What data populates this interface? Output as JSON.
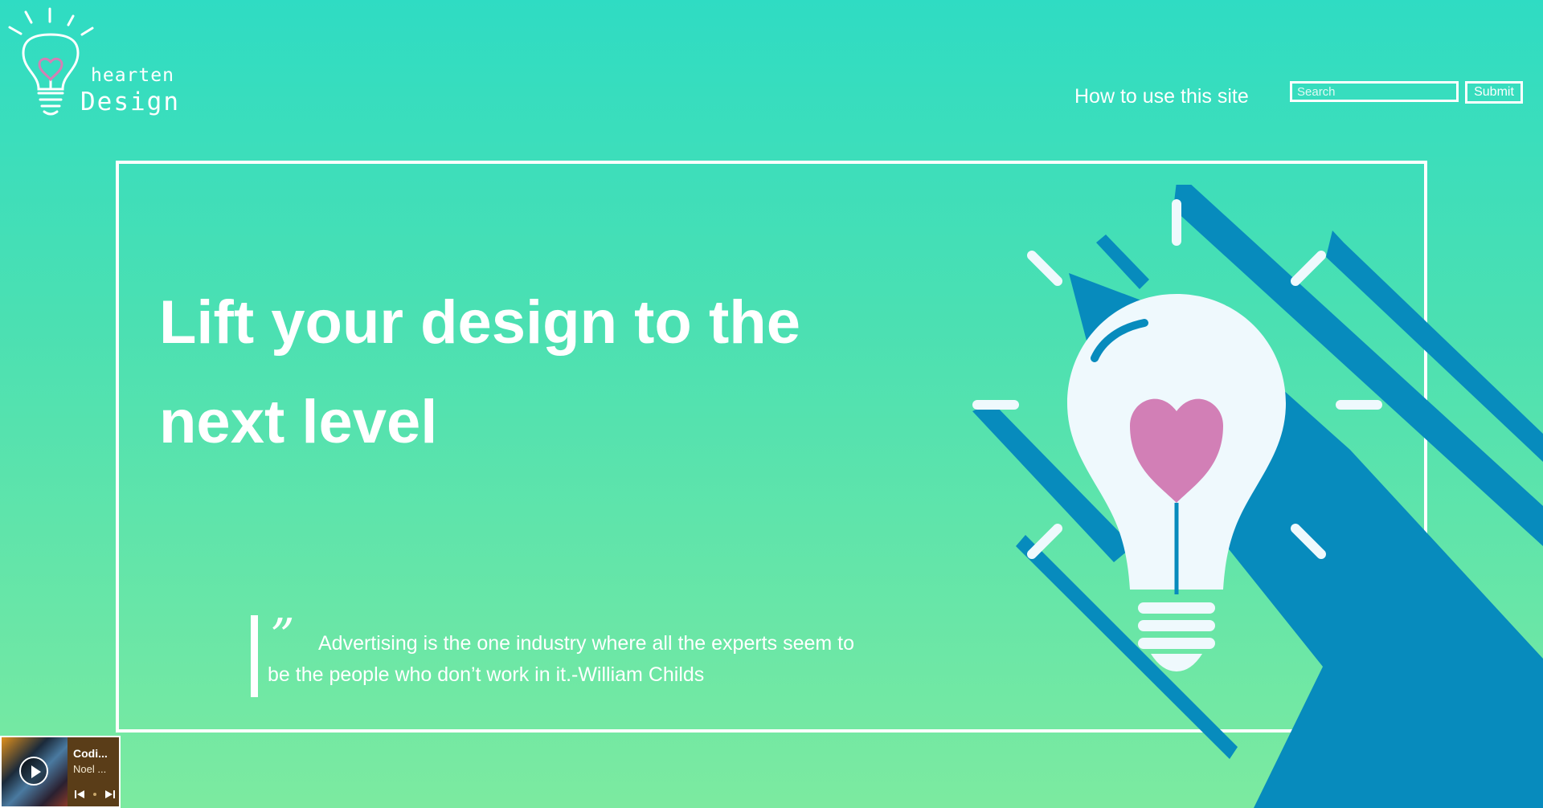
{
  "header": {
    "logo": {
      "line1": "hearten",
      "line2": "Design"
    },
    "nav_link": "How to use this site",
    "search": {
      "placeholder": "Search",
      "value": ""
    },
    "submit_label": "Submit"
  },
  "hero": {
    "title": "Lift your design to the next level",
    "quote_mark": "”",
    "quote": "Advertising is the one industry where all the experts seem to be the people who don’t work in it.-William Childs",
    "illustration": "lightbulb-heart-icon"
  },
  "player": {
    "title": "Codi...",
    "artist": "Noel ..."
  },
  "colors": {
    "background_top": "#2fdcc3",
    "background_bottom": "#7ceaa0",
    "shadow_blue": "#078bbd",
    "bulb_white": "#eff9fd",
    "heart_pink": "#d27fb6"
  }
}
